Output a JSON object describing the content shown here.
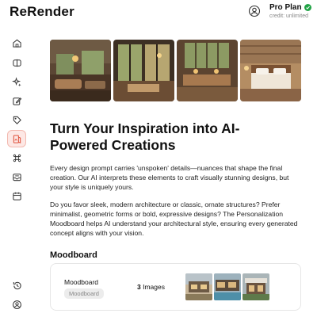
{
  "app": {
    "title": "ReRender"
  },
  "account": {
    "plan": "Pro Plan",
    "credit": "credit: unlimited",
    "accent": "#22a447"
  },
  "sidebar": {
    "items": [
      {
        "icon": "home-icon"
      },
      {
        "icon": "compare-icon"
      },
      {
        "icon": "sparkle-icon"
      },
      {
        "icon": "edit-icon"
      },
      {
        "icon": "tag-icon"
      },
      {
        "icon": "moodboard-icon",
        "active": true
      },
      {
        "icon": "command-icon"
      },
      {
        "icon": "inbox-icon"
      },
      {
        "icon": "calendar-icon"
      },
      {
        "icon": "history-icon"
      },
      {
        "icon": "profile-icon"
      }
    ],
    "active_color": "#f3b9b0"
  },
  "main": {
    "title": "Turn Your Inspiration into AI-Powered Creations",
    "paragraph1": "Every design prompt carries 'unspoken' details—nuances that shape the final creation. Our AI interprets these elements to craft visually stunning designs, but your style is uniquely yours.",
    "paragraph2": "Do you favor sleek, modern architecture or classic, ornate structures? Prefer minimalist, geometric forms or bold, expressive designs? The Personalization Moodboard helps AI understand your architectural style, ensuring every generated concept aligns with your vision.",
    "section_title": "Moodboard"
  },
  "moodboard_card": {
    "name": "Moodboard",
    "tag": "Moodboard",
    "count": "3",
    "count_label": "Images"
  }
}
